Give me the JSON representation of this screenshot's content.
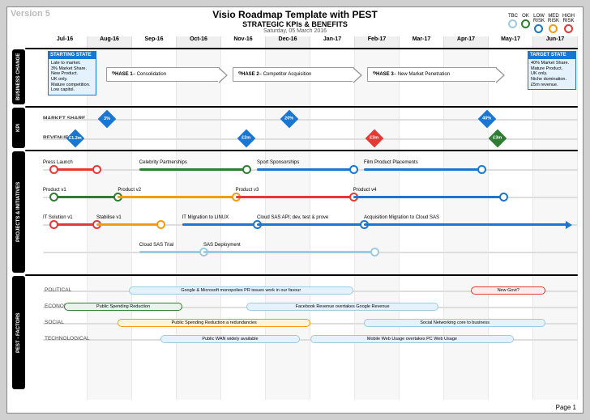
{
  "version": "Version 5",
  "title": "Visio Roadmap Template with PEST",
  "subtitle": "STRATEGIC KPIs & BENEFITS",
  "date": "Saturday, 05 March 2016",
  "footer": "Page 1",
  "legend": [
    {
      "label": "TBC",
      "color": "#9ecae1"
    },
    {
      "label": "OK",
      "color": "#2e7d32"
    },
    {
      "label": "LOW RISK",
      "color": "#1976d2"
    },
    {
      "label": "MED RISK",
      "color": "#f39c12"
    },
    {
      "label": "HIGH RISK",
      "color": "#e53935"
    }
  ],
  "months": [
    "Jul-16",
    "Aug-16",
    "Sep-16",
    "Oct-16",
    "Nov-16",
    "Dec-16",
    "Jan-17",
    "Feb-17",
    "Mar-17",
    "Apr-17",
    "May-17",
    "Jun-17"
  ],
  "sections": {
    "business": {
      "label": "BUSINESS CHANGE",
      "start_state": {
        "hdr": "STARTING STATE",
        "lines": [
          "Late to market.",
          "3% Market Share.",
          "New Product.",
          "UK only.",
          "Mature competition.",
          "Low capitol."
        ]
      },
      "target_state": {
        "hdr": "TARGET STATE",
        "lines": [
          "40% Market Share.",
          "Mature Product.",
          "UK only.",
          "Niche domination.",
          "£5m revenue."
        ]
      },
      "phases": [
        {
          "bold": "PHASE 1",
          "rest": " – Consolidation"
        },
        {
          "bold": "PHASE 2",
          "rest": " – Competitor Acquisition"
        },
        {
          "bold": "PHASE 3",
          "rest": " – New Market Penetration"
        }
      ]
    },
    "kpi": {
      "label": "KPI",
      "rows": [
        {
          "name": "MARKET SHARE",
          "markers": [
            {
              "pos": 12,
              "val": "3%",
              "color": "#1976d2"
            },
            {
              "pos": 46,
              "val": "20%",
              "color": "#1976d2"
            },
            {
              "pos": 83,
              "val": "40%",
              "color": "#1976d2"
            }
          ]
        },
        {
          "name": "REVENUE",
          "markers": [
            {
              "pos": 6,
              "val": "£1.2m",
              "color": "#1976d2"
            },
            {
              "pos": 38,
              "val": "£2m",
              "color": "#1976d2"
            },
            {
              "pos": 62,
              "val": "£3m",
              "color": "#e53935"
            },
            {
              "pos": 85,
              "val": "£3m",
              "color": "#2e7d32"
            }
          ]
        }
      ]
    },
    "projects": {
      "label": "PROJECTS & INITIATIVES",
      "bars": [
        {
          "y": 0,
          "label": "Press Launch",
          "labelX": 0,
          "start": 2,
          "end": 10,
          "color": "#e53935",
          "ringStart": true,
          "ringEnd": true
        },
        {
          "y": 0,
          "label": "Celebrity Partnerships",
          "labelX": 18,
          "start": 18,
          "end": 38,
          "color": "#2e7d32",
          "ringEnd": true
        },
        {
          "y": 0,
          "label": "Sport Sponsorships",
          "labelX": 40,
          "start": 40,
          "end": 58,
          "color": "#1976d2",
          "ringEnd": true
        },
        {
          "y": 0,
          "label": "Film Product Placements",
          "labelX": 60,
          "start": 60,
          "end": 82,
          "color": "#1976d2",
          "ringEnd": true
        },
        {
          "y": 1,
          "label": "Product v1",
          "labelX": 0,
          "start": 2,
          "end": 14,
          "color": "#2e7d32",
          "ringStart": true,
          "ringEnd": true
        },
        {
          "y": 1,
          "label": "Product v2",
          "labelX": 14,
          "start": 14,
          "end": 36,
          "color": "#f39c12",
          "ringEnd": true
        },
        {
          "y": 1,
          "label": "Product v3",
          "labelX": 36,
          "start": 36,
          "end": 58,
          "color": "#e53935",
          "ringEnd": true
        },
        {
          "y": 1,
          "label": "Product v4",
          "labelX": 58,
          "start": 58,
          "end": 86,
          "color": "#1976d2",
          "ringEnd": true
        },
        {
          "y": 2,
          "label": "IT Solution v1",
          "labelX": 0,
          "start": 2,
          "end": 10,
          "color": "#e53935",
          "ringStart": true,
          "ringEnd": true
        },
        {
          "y": 2,
          "label": "Stabilise v1",
          "labelX": 10,
          "start": 10,
          "end": 22,
          "color": "#f39c12",
          "ringEnd": true
        },
        {
          "y": 2,
          "label": "IT Migration to LINUX",
          "labelX": 26,
          "start": 26,
          "end": 40,
          "color": "#1976d2",
          "ringEnd": true
        },
        {
          "y": 2,
          "label": "Cloud SAS API; dev, test & prove",
          "labelX": 40,
          "start": 40,
          "end": 60,
          "color": "#1976d2",
          "ringEnd": true
        },
        {
          "y": 2,
          "label": "Acquisition Migration to Cloud SAS",
          "labelX": 60,
          "start": 60,
          "end": 98,
          "color": "#1976d2",
          "arrowEnd": true
        },
        {
          "y": 3,
          "label": "Cloud SAS Trial",
          "labelX": 18,
          "start": 18,
          "end": 30,
          "color": "#9ecae1",
          "ringEnd": true
        },
        {
          "y": 3,
          "label": "SAS Deployment",
          "labelX": 30,
          "start": 30,
          "end": 62,
          "color": "#9ecae1",
          "ringEnd": true
        }
      ]
    },
    "pest": {
      "label": "PEST - FACTORS",
      "rows": [
        {
          "name": "POLITICAL",
          "bars": [
            {
              "start": 16,
              "end": 58,
              "text": "Google & Microsoft monopolies PR issues work in our favour",
              "color": "#9ecae1"
            },
            {
              "start": 80,
              "end": 94,
              "text": "New Govt?",
              "color": "#e53935"
            }
          ]
        },
        {
          "name": "ECONOMICAL",
          "bars": [
            {
              "start": 4,
              "end": 26,
              "text": "Public Spending Reduction",
              "color": "#2e7d32"
            },
            {
              "start": 38,
              "end": 74,
              "text": "Facebook Revenue overtakes Google Revenue",
              "color": "#9ecae1"
            }
          ]
        },
        {
          "name": "SOCIAL",
          "bars": [
            {
              "start": 14,
              "end": 50,
              "text": "Public Spending Reduction a redundancies",
              "color": "#f39c12"
            },
            {
              "start": 60,
              "end": 94,
              "text": "Social Networking core to business",
              "color": "#9ecae1"
            }
          ]
        },
        {
          "name": "TECHNOLOGICAL",
          "bars": [
            {
              "start": 22,
              "end": 48,
              "text": "Public WAN widely available",
              "color": "#9ecae1"
            },
            {
              "start": 50,
              "end": 88,
              "text": "Mobile Web Usage overtakes PC Web Usage",
              "color": "#9ecae1"
            }
          ]
        }
      ]
    }
  }
}
